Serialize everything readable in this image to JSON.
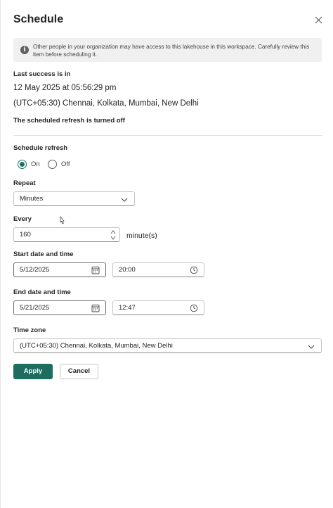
{
  "dialog": {
    "title": "Schedule",
    "close_label": "×"
  },
  "banner": {
    "icon": "info-icon",
    "message": "Other people in your organization may have access to this lakehouse in this workspace. Carefully review this item before scheduling it."
  },
  "last_success": {
    "label": "Last success is in",
    "datetime": "12 May 2025 at 05:56:29 pm",
    "timezone": "(UTC+05:30) Chennai, Kolkata, Mumbai, New Delhi",
    "status": "The scheduled refresh is turned off"
  },
  "schedule_refresh": {
    "label": "Schedule refresh",
    "options": [
      {
        "label": "On",
        "checked": true
      },
      {
        "label": "Off",
        "checked": false
      }
    ]
  },
  "repeat": {
    "label": "Repeat",
    "value": "Minutes"
  },
  "every": {
    "label": "Every",
    "value": "160",
    "unit": "minute(s)"
  },
  "start": {
    "label": "Start date and time",
    "date": "5/12/2025",
    "time": "20:00"
  },
  "end": {
    "label": "End date and time",
    "date": "5/21/2025",
    "time": "12:47"
  },
  "time_zone": {
    "label": "Time zone",
    "value": "(UTC+05:30) Chennai, Kolkata, Mumbai, New Delhi"
  },
  "actions": {
    "apply": "Apply",
    "cancel": "Cancel"
  },
  "colors": {
    "accent": "#1e6b5f",
    "radio_selected": "#1e7064",
    "banner_bg": "#f0f0f0"
  }
}
